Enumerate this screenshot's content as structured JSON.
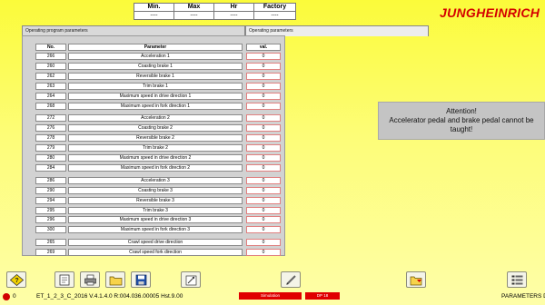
{
  "header": {
    "columns": [
      "Min.",
      "Max",
      "Hr",
      "Factory"
    ],
    "values": [
      "----",
      "----",
      "----",
      "----"
    ],
    "logo_text": "JUNGHEINRICH"
  },
  "tabs": [
    {
      "label": "Operating program parameters"
    },
    {
      "label": "Operating parameters"
    }
  ],
  "table": {
    "headers": {
      "no": "No.",
      "parameter": "Parameter",
      "val": "val."
    },
    "rows": [
      {
        "no": "266",
        "parameter": "Acceleration 1",
        "val": "0"
      },
      {
        "no": "260",
        "parameter": "Coasting brake 1",
        "val": "0"
      },
      {
        "no": "262",
        "parameter": "Reversible brake 1",
        "val": "0"
      },
      {
        "no": "263",
        "parameter": "Trim brake 1",
        "val": "0"
      },
      {
        "no": "264",
        "parameter": "Maximum speed in drive direction 1",
        "val": "0"
      },
      {
        "no": "268",
        "parameter": "Maximum speed in fork direction 1",
        "val": "0"
      },
      {
        "no": "272",
        "parameter": "Acceleration 2",
        "val": "0"
      },
      {
        "no": "276",
        "parameter": "Coasting brake 2",
        "val": "0"
      },
      {
        "no": "278",
        "parameter": "Reversible brake 2",
        "val": "0"
      },
      {
        "no": "279",
        "parameter": "Trim brake 2",
        "val": "0"
      },
      {
        "no": "280",
        "parameter": "Maximum speed in drive direction 2",
        "val": "0"
      },
      {
        "no": "284",
        "parameter": "Maximum speed in fork direction 2",
        "val": "0"
      },
      {
        "no": "286",
        "parameter": "Acceleration 3",
        "val": "0"
      },
      {
        "no": "290",
        "parameter": "Coasting brake 3",
        "val": "0"
      },
      {
        "no": "294",
        "parameter": "Reversible brake 3",
        "val": "0"
      },
      {
        "no": "295",
        "parameter": "Trim brake 3",
        "val": "0"
      },
      {
        "no": "296",
        "parameter": "Maximum speed in drive direction 3",
        "val": "0"
      },
      {
        "no": "300",
        "parameter": "Maximum speed in fork direction 3",
        "val": "0"
      },
      {
        "no": "265",
        "parameter": "Crawl speed drive direction",
        "val": "0"
      },
      {
        "no": "269",
        "parameter": "Crawl speed fork direction",
        "val": "0"
      }
    ]
  },
  "attention": {
    "title": "Attention!",
    "message": "Accelerator pedal and brake pedal cannot be taught!"
  },
  "toolbar": {
    "icons": [
      "help-icon",
      "edit-icon",
      "print-icon",
      "folder-icon",
      "save-icon",
      "export-icon",
      "pen-icon",
      "open-folder-icon",
      "parameters-list-icon"
    ]
  },
  "status": {
    "number": "0",
    "file": "ET_1_2_3_C_2016 V.4.1.4.0 R:004.036.00005 Hst.9.00",
    "red_label_1": "Simulation",
    "red_label_2": "DP 18",
    "parameters": "PARAMETERS D"
  },
  "colors": {
    "background": "#fbfb3a",
    "logo": "#d40000",
    "panel": "#d2d2d2",
    "status_red": "#e00000"
  }
}
